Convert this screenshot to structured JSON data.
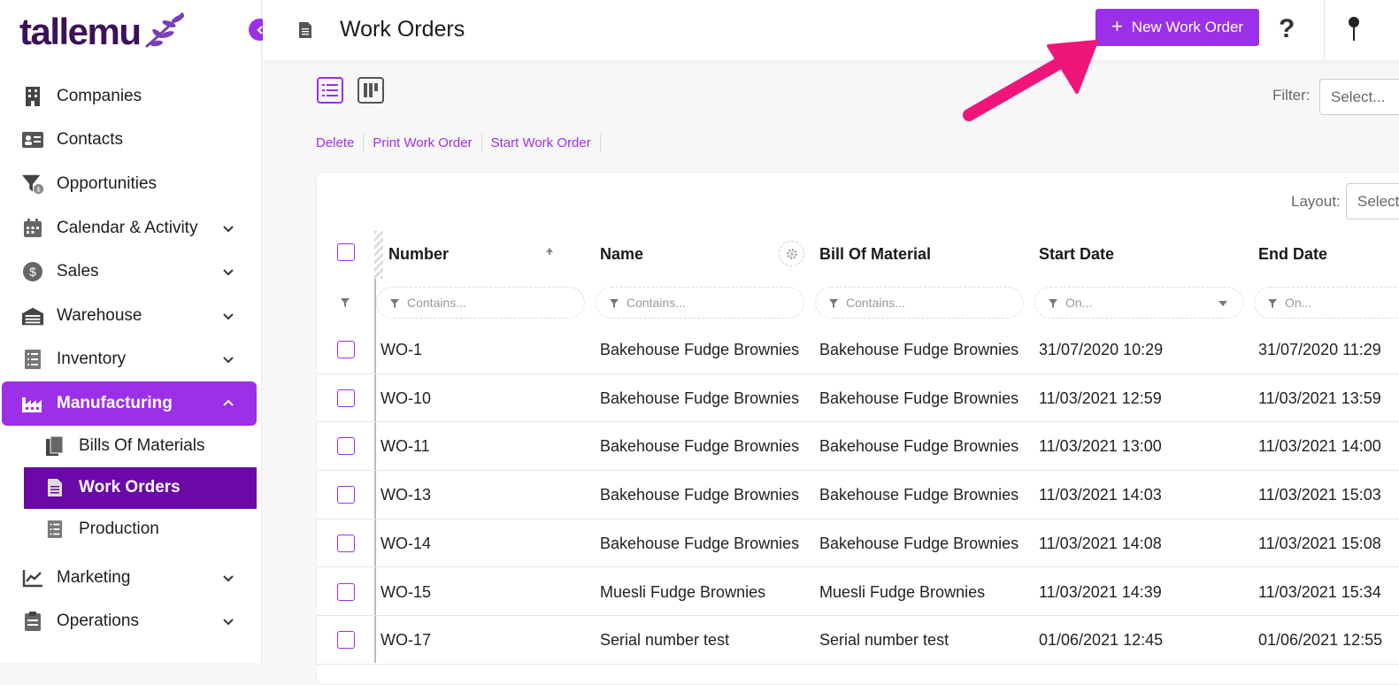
{
  "app": {
    "logo": "tallemu"
  },
  "sidebar": {
    "items": [
      {
        "label": "Companies",
        "icon": "building-icon",
        "expandable": false
      },
      {
        "label": "Contacts",
        "icon": "contact-card-icon",
        "expandable": false
      },
      {
        "label": "Opportunities",
        "icon": "funnel-dollar-icon",
        "expandable": false
      },
      {
        "label": "Calendar & Activity",
        "icon": "calendar-icon",
        "expandable": true
      },
      {
        "label": "Sales",
        "icon": "dollar-circle-icon",
        "expandable": true
      },
      {
        "label": "Warehouse",
        "icon": "warehouse-icon",
        "expandable": true
      },
      {
        "label": "Inventory",
        "icon": "checklist-icon",
        "expandable": true
      },
      {
        "label": "Manufacturing",
        "icon": "factory-icon",
        "expandable": true,
        "active": true
      },
      {
        "label": "Marketing",
        "icon": "chart-line-icon",
        "expandable": true
      },
      {
        "label": "Operations",
        "icon": "clipboard-icon",
        "expandable": true
      }
    ],
    "sub_items": [
      {
        "label": "Bills Of Materials",
        "icon": "copy-docs-icon"
      },
      {
        "label": "Work Orders",
        "icon": "document-icon",
        "active": true
      },
      {
        "label": "Production",
        "icon": "checklist-icon"
      }
    ]
  },
  "header": {
    "title": "Work Orders",
    "new_button": "New Work Order",
    "new_button_plus": "+",
    "help": "?"
  },
  "toolbar": {
    "filter_label": "Filter:",
    "filter_placeholder": "Select...",
    "actions": [
      "Delete",
      "Print Work Order",
      "Start Work Order"
    ],
    "layout_label": "Layout:",
    "layout_placeholder": "Select"
  },
  "table": {
    "columns": [
      "Number",
      "Name",
      "Bill Of Material",
      "Start Date",
      "End Date"
    ],
    "filters": [
      "Contains...",
      "Contains...",
      "Contains...",
      "On...",
      "On..."
    ],
    "rows": [
      [
        "WO-1",
        "Bakehouse Fudge Brownies",
        "Bakehouse Fudge Brownies",
        "31/07/2020 10:29",
        "31/07/2020 11:29"
      ],
      [
        "WO-10",
        "Bakehouse Fudge Brownies",
        "Bakehouse Fudge Brownies",
        "11/03/2021 12:59",
        "11/03/2021 13:59"
      ],
      [
        "WO-11",
        "Bakehouse Fudge Brownies",
        "Bakehouse Fudge Brownies",
        "11/03/2021 13:00",
        "11/03/2021 14:00"
      ],
      [
        "WO-13",
        "Bakehouse Fudge Brownies",
        "Bakehouse Fudge Brownies",
        "11/03/2021 14:03",
        "11/03/2021 15:03"
      ],
      [
        "WO-14",
        "Bakehouse Fudge Brownies",
        "Bakehouse Fudge Brownies",
        "11/03/2021 14:08",
        "11/03/2021 15:08"
      ],
      [
        "WO-15",
        "Muesli Fudge Brownies",
        "Muesli Fudge Brownies",
        "11/03/2021 14:39",
        "11/03/2021 15:34"
      ],
      [
        "WO-17",
        "Serial number test",
        "Serial number test",
        "01/06/2021 12:45",
        "01/06/2021 12:55"
      ]
    ]
  },
  "colors": {
    "accent": "#9b30e8",
    "active_sub": "#6a08a8",
    "logo": "#3b1258",
    "annotation_arrow": "#f0157a"
  }
}
